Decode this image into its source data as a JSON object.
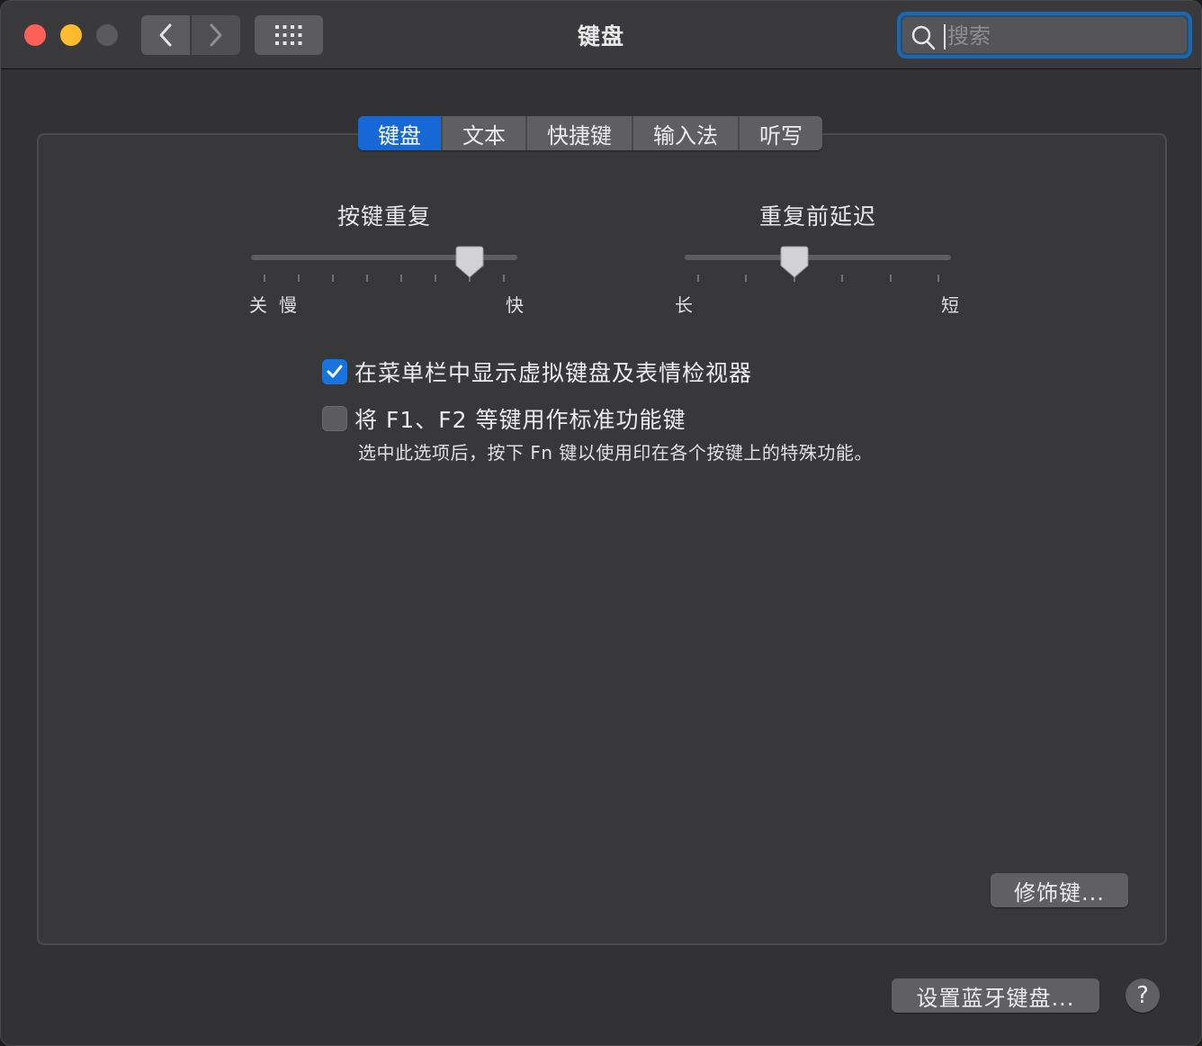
{
  "window": {
    "title": "键盘"
  },
  "toolbar": {
    "back_icon": "chevron-left-icon",
    "forward_icon": "chevron-right-icon",
    "grid_icon": "grid-icon"
  },
  "search": {
    "placeholder": "搜索",
    "value": ""
  },
  "tabs": [
    {
      "label": "键盘",
      "active": true
    },
    {
      "label": "文本",
      "active": false
    },
    {
      "label": "快捷键",
      "active": false
    },
    {
      "label": "输入法",
      "active": false
    },
    {
      "label": "听写",
      "active": false
    }
  ],
  "key_repeat": {
    "label": "按键重复",
    "off_label": "关",
    "slow_label": "慢",
    "fast_label": "快",
    "ticks": 8,
    "value_tick": 6
  },
  "delay_until_repeat": {
    "label": "重复前延迟",
    "long_label": "长",
    "short_label": "短",
    "ticks": 6,
    "value_tick": 2
  },
  "options": {
    "show_viewer": {
      "label": "在菜单栏中显示虚拟键盘及表情检视器",
      "checked": true
    },
    "fn_keys": {
      "label": "将 F1、F2 等键用作标准功能键",
      "checked": false,
      "description": "选中此选项后，按下 Fn 键以使用印在各个按键上的特殊功能。"
    }
  },
  "buttons": {
    "modifier": "修饰键...",
    "bluetooth": "设置蓝牙键盘...",
    "help": "?"
  },
  "colors": {
    "accent": "#1668d6",
    "checkbox": "#1673e0"
  }
}
